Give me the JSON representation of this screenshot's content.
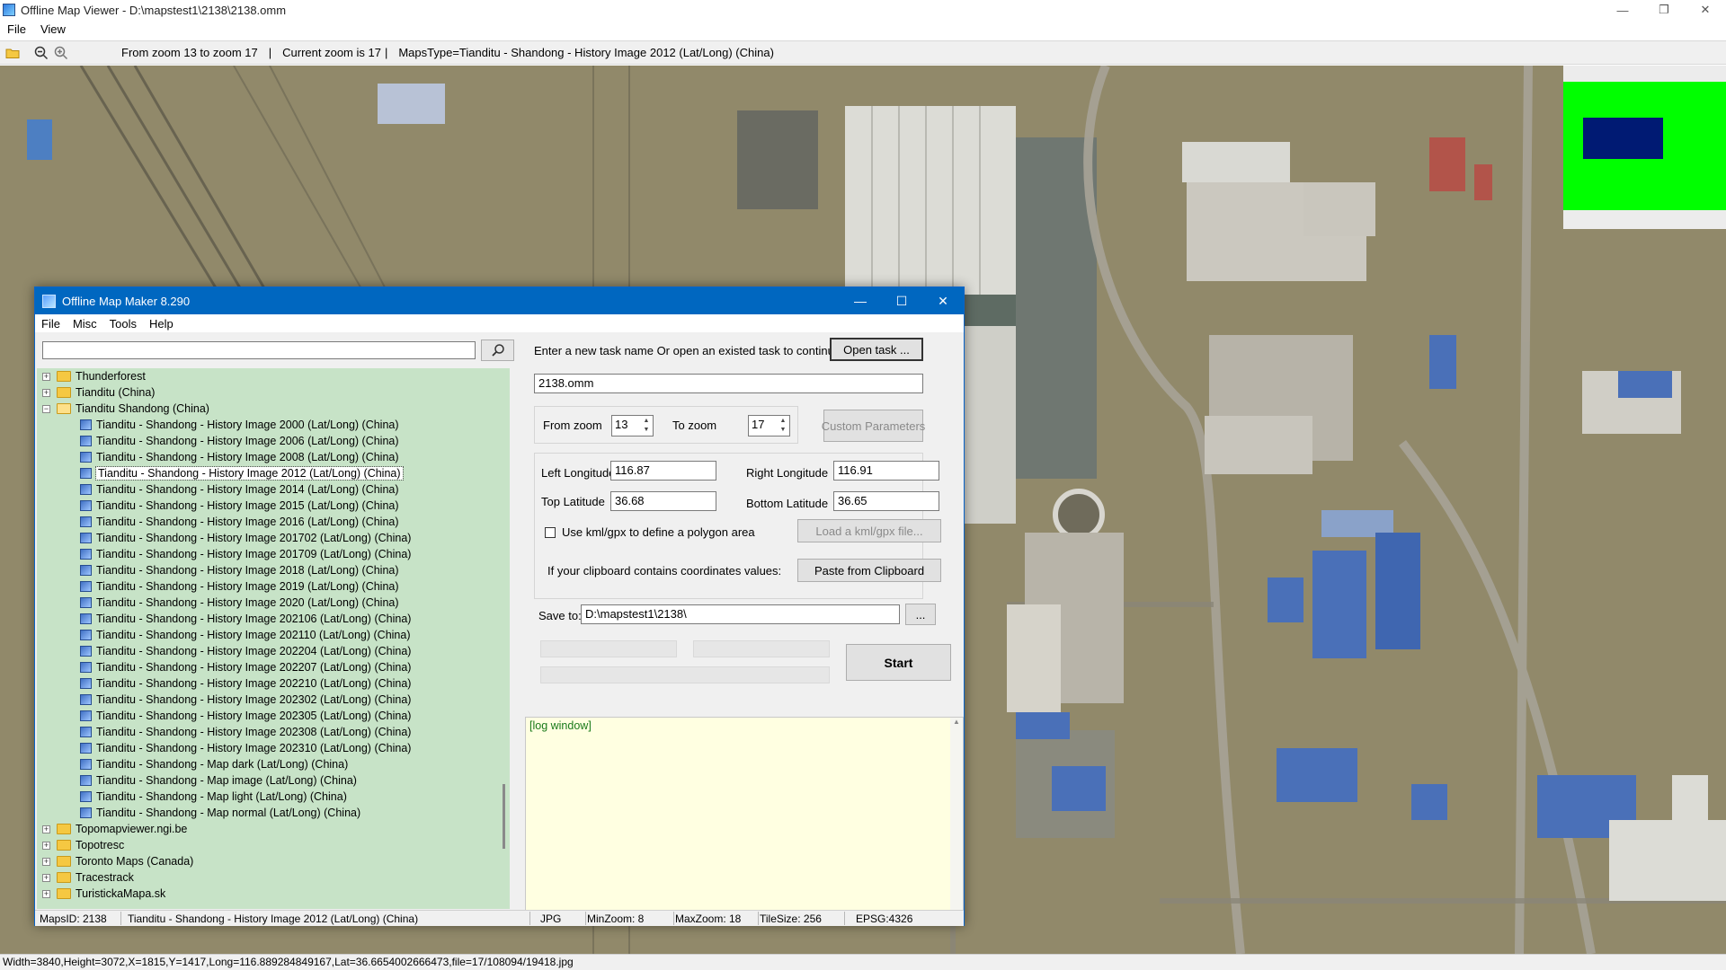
{
  "viewer": {
    "title": "Offline Map Viewer - D:\\mapstest1\\2138\\2138.omm",
    "menu": [
      "File",
      "View"
    ],
    "window_buttons": {
      "minimize": "—",
      "restore": "❐",
      "close": "✕"
    },
    "toolbar": {
      "zoom_range": "From zoom 13 to zoom 17",
      "current_zoom": "Current zoom is 17",
      "maps_type": "MapsType=Tianditu - Shandong - History Image 2012 (Lat/Long) (China)",
      "separator": "|"
    },
    "status": "Width=3840,Height=3072,X=1815,Y=1417,Long=116.889284849167,Lat=36.6654002666473,file=17/108094/19418.jpg",
    "overview_colors": {
      "frame": "#00ff00",
      "viewport": "#001a73"
    }
  },
  "dialog": {
    "title": "Offline Map Maker 8.290",
    "menu": [
      "File",
      "Misc",
      "Tools",
      "Help"
    ],
    "search_value": "",
    "tree": {
      "selected": "Tianditu - Shandong - History Image 2012 (Lat/Long) (China)",
      "items": [
        {
          "label": "Thunderforest",
          "level": 0,
          "type": "folder",
          "expander": "+"
        },
        {
          "label": "Tianditu (China)",
          "level": 0,
          "type": "folder",
          "expander": "+"
        },
        {
          "label": "Tianditu Shandong (China)",
          "level": 0,
          "type": "folder-open",
          "expander": "−"
        },
        {
          "label": "Tianditu - Shandong - History Image 2000 (Lat/Long) (China)",
          "level": 1,
          "type": "map"
        },
        {
          "label": "Tianditu - Shandong - History Image 2006 (Lat/Long) (China)",
          "level": 1,
          "type": "map"
        },
        {
          "label": "Tianditu - Shandong - History Image 2008 (Lat/Long) (China)",
          "level": 1,
          "type": "map"
        },
        {
          "label": "Tianditu - Shandong - History Image 2012 (Lat/Long) (China)",
          "level": 1,
          "type": "map",
          "selected": true
        },
        {
          "label": "Tianditu - Shandong - History Image 2014 (Lat/Long) (China)",
          "level": 1,
          "type": "map"
        },
        {
          "label": "Tianditu - Shandong - History Image 2015 (Lat/Long) (China)",
          "level": 1,
          "type": "map"
        },
        {
          "label": "Tianditu - Shandong - History Image 2016 (Lat/Long) (China)",
          "level": 1,
          "type": "map"
        },
        {
          "label": "Tianditu - Shandong - History Image 201702 (Lat/Long) (China)",
          "level": 1,
          "type": "map"
        },
        {
          "label": "Tianditu - Shandong - History Image 201709 (Lat/Long) (China)",
          "level": 1,
          "type": "map"
        },
        {
          "label": "Tianditu - Shandong - History Image 2018 (Lat/Long) (China)",
          "level": 1,
          "type": "map"
        },
        {
          "label": "Tianditu - Shandong - History Image 2019 (Lat/Long) (China)",
          "level": 1,
          "type": "map"
        },
        {
          "label": "Tianditu - Shandong - History Image 2020 (Lat/Long) (China)",
          "level": 1,
          "type": "map"
        },
        {
          "label": "Tianditu - Shandong - History Image 202106 (Lat/Long) (China)",
          "level": 1,
          "type": "map"
        },
        {
          "label": "Tianditu - Shandong - History Image 202110 (Lat/Long) (China)",
          "level": 1,
          "type": "map"
        },
        {
          "label": "Tianditu - Shandong - History Image 202204 (Lat/Long) (China)",
          "level": 1,
          "type": "map"
        },
        {
          "label": "Tianditu - Shandong - History Image 202207 (Lat/Long) (China)",
          "level": 1,
          "type": "map"
        },
        {
          "label": "Tianditu - Shandong - History Image 202210 (Lat/Long) (China)",
          "level": 1,
          "type": "map"
        },
        {
          "label": "Tianditu - Shandong - History Image 202302 (Lat/Long) (China)",
          "level": 1,
          "type": "map"
        },
        {
          "label": "Tianditu - Shandong - History Image 202305 (Lat/Long) (China)",
          "level": 1,
          "type": "map"
        },
        {
          "label": "Tianditu - Shandong - History Image 202308 (Lat/Long) (China)",
          "level": 1,
          "type": "map"
        },
        {
          "label": "Tianditu - Shandong - History Image 202310 (Lat/Long) (China)",
          "level": 1,
          "type": "map"
        },
        {
          "label": "Tianditu - Shandong - Map dark (Lat/Long) (China)",
          "level": 1,
          "type": "map"
        },
        {
          "label": "Tianditu - Shandong - Map image (Lat/Long) (China)",
          "level": 1,
          "type": "map"
        },
        {
          "label": "Tianditu - Shandong - Map light (Lat/Long) (China)",
          "level": 1,
          "type": "map"
        },
        {
          "label": "Tianditu - Shandong - Map normal (Lat/Long) (China)",
          "level": 1,
          "type": "map"
        },
        {
          "label": "Topomapviewer.ngi.be",
          "level": 0,
          "type": "folder",
          "expander": "+"
        },
        {
          "label": "Topotresc",
          "level": 0,
          "type": "folder",
          "expander": "+"
        },
        {
          "label": "Toronto Maps (Canada)",
          "level": 0,
          "type": "folder",
          "expander": "+"
        },
        {
          "label": "Tracestrack",
          "level": 0,
          "type": "folder",
          "expander": "+"
        },
        {
          "label": "TuristickaMapa.sk",
          "level": 0,
          "type": "folder",
          "expander": "+"
        }
      ]
    },
    "task": {
      "prompt": "Enter a new task name Or open an existed task to continue:",
      "open_button": "Open task ...",
      "name_value": "2138.omm"
    },
    "zoom": {
      "from_label": "From zoom",
      "from_value": "13",
      "to_label": "To zoom",
      "to_value": "17",
      "custom_button": "Custom Parameters"
    },
    "coords": {
      "left_label": "Left Longitude",
      "left_value": "116.87",
      "right_label": "Right Longitude",
      "right_value": "116.91",
      "top_label": "Top Latitude",
      "top_value": "36.68",
      "bottom_label": "Bottom Latitude",
      "bottom_value": "36.65",
      "kml_checkbox_label": "Use kml/gpx to define a polygon area",
      "kml_checked": false,
      "kml_button": "Load a kml/gpx file...",
      "clipboard_label": "If your clipboard contains coordinates values:",
      "clipboard_button": "Paste from Clipboard"
    },
    "save": {
      "label": "Save to:",
      "value": "D:\\mapstest1\\2138\\",
      "browse_button": "..."
    },
    "start_button": "Start",
    "progress": {
      "bar1": 0,
      "bar2": 0,
      "bar3": 0
    },
    "log_text": "[log window]",
    "status": {
      "maps_id": "MapsID: 2138",
      "map_name": "Tianditu - Shandong - History Image 2012 (Lat/Long) (China)",
      "format": "JPG",
      "min_zoom": "MinZoom: 8",
      "max_zoom": "MaxZoom: 18",
      "tile_size": "TileSize: 256",
      "epsg": "EPSG:4326"
    }
  }
}
